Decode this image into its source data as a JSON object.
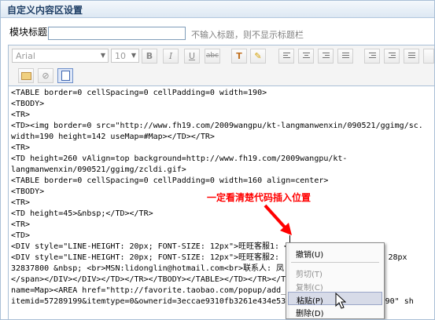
{
  "panel": {
    "title": "自定义内容区设置"
  },
  "form": {
    "title_label": "模块标题",
    "title_value": "",
    "title_hint": "不输入标题，则不显示标题栏"
  },
  "toolbar": {
    "font_value": "Arial",
    "size_value": "10",
    "bold": "B",
    "italic": "I",
    "underline": "U",
    "strike": "abc"
  },
  "code_lines": [
    "<TABLE border=0 cellSpacing=0 cellPadding=0 width=190>",
    "<TBODY>",
    "<TR>",
    "<TD><img border=0 src=\"http://www.fh19.com/2009wangpu/kt-langmanwenxin/090521/ggimg/sc.",
    "width=190 height=142 useMap=#Map></TD></TR>",
    "<TR>",
    "<TD height=260 vAlign=top background=http://www.fh19.com/2009wangpu/kt-",
    "langmanwenxin/090521/ggimg/zcldi.gif>",
    "<TABLE border=0 cellSpacing=0 cellPadding=0 width=160 align=center>",
    "<TBODY>",
    "<TR>",
    "<TD height=45>&nbsp;</TD></TR>",
    "<TR>",
    "<TD>",
    "<DIV style=\"LINE-HEIGHT: 20px; FONT-SIZE: 12px\">旺旺客服1: <br>",
    "<DIV style=\"LINE-HEIGHT: 20px; FONT-SIZE: 12px\">旺旺客服2:                 IGHT: 28px",
    "32837800 &nbsp; <br>MSN:lidonglin@hotmail.com<br>联系人: 凤",
    "</span></DIV></DIV></TD></TR></TBODY></TABLE></TD></TR></T                d=Map",
    "name=Map><AREA href=\"http://favorite.taobao.com/popup/add_",
    "itemid=57289199&itemtype=0&ownerid=3eccae9310fb3261e434e53                 425890\" sh"
  ],
  "annotation": {
    "text": "一定看清楚代码插入位置"
  },
  "context_menu": {
    "items": [
      {
        "label": "撤销(U)",
        "enabled": true
      },
      {
        "label": "剪切(T)",
        "enabled": false
      },
      {
        "label": "复制(C)",
        "enabled": false
      },
      {
        "label": "粘贴(P)",
        "enabled": true,
        "highlighted": true
      },
      {
        "label": "删除(D)",
        "enabled": true
      }
    ]
  }
}
